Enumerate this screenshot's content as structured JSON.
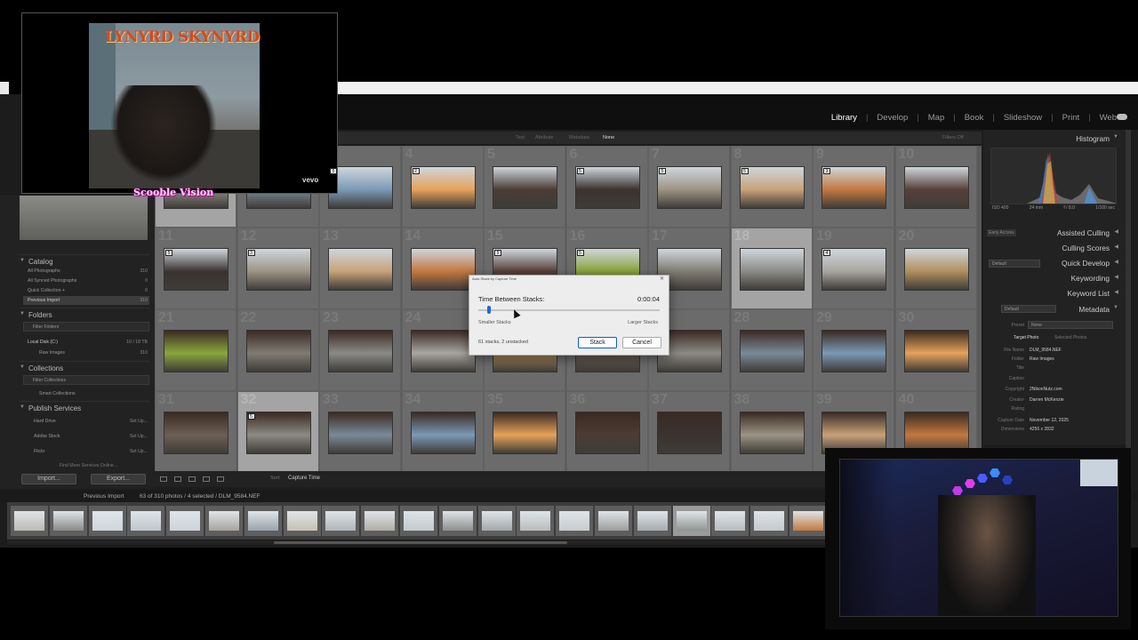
{
  "modules": [
    "Library",
    "Develop",
    "Map",
    "Book",
    "Slideshow",
    "Print",
    "Web"
  ],
  "active_module": "Library",
  "filter_bar": {
    "items": [
      "Text",
      "Attribute",
      "Metadata",
      "None"
    ],
    "right": "Filters Off"
  },
  "left_panel": {
    "catalog_title": "Catalog",
    "catalog_items": [
      {
        "label": "All Photographs",
        "count": "310"
      },
      {
        "label": "All Synced Photographs",
        "count": "0"
      },
      {
        "label": "Quick Collection +",
        "count": "0"
      },
      {
        "label": "Previous Import",
        "count": "310"
      }
    ],
    "folders_title": "Folders",
    "folders_filter": "Filter Folders",
    "disk_label": "Local Disk (C:)",
    "disk_info": "10 / 18 TB",
    "folder_item": {
      "label": "Raw Images",
      "count": "310"
    },
    "collections_title": "Collections",
    "collections_filter": "Filter Collections",
    "smart_collections": "Smart Collections",
    "publish_title": "Publish Services",
    "publish_items": [
      {
        "label": "Hard Drive",
        "action": "Set Up..."
      },
      {
        "label": "Adobe Stock",
        "action": "Set Up..."
      },
      {
        "label": "Flickr",
        "action": "Set Up..."
      }
    ],
    "find_more": "Find More Services Online...",
    "import_label": "Import...",
    "export_label": "Export..."
  },
  "grid": {
    "numbers": [
      "",
      "",
      "3",
      "4",
      "5",
      "6",
      "7",
      "8",
      "9",
      "10",
      "11",
      "12",
      "13",
      "14",
      "15",
      "16",
      "17",
      "18",
      "19",
      "20",
      "21",
      "22",
      "23",
      "24",
      "25",
      "26",
      "27",
      "28",
      "29",
      "30",
      "31",
      "32",
      "33",
      "34",
      "35",
      "36",
      "37",
      "38",
      "39",
      "40"
    ],
    "stack_badges": [
      "",
      "",
      "5",
      "2",
      "",
      "5",
      "5",
      "5",
      "3",
      "",
      "5",
      "3",
      "",
      "",
      "5",
      "5",
      "",
      "",
      "4",
      "",
      "",
      "",
      "",
      "",
      "",
      "",
      "",
      "",
      "",
      "",
      "",
      "5",
      "",
      "",
      "",
      "",
      "",
      "",
      "",
      ""
    ]
  },
  "toolbar": {
    "sort_label": "Sort:",
    "sort_value": "Capture Time"
  },
  "right_panel": {
    "histogram_title": "Histogram",
    "hist_info": [
      "ISO 400",
      "24 mm",
      "f / 8.0",
      "1/160 sec"
    ],
    "early_access": "Early Access",
    "sections": [
      "Assisted Culling",
      "Culling Scores",
      "Quick Develop",
      "Keywording",
      "Keyword List",
      "Metadata"
    ],
    "default_label": "Default",
    "preset_label": "Preset",
    "preset_value": "None",
    "target_photo": "Target Photo",
    "selected_photos": "Selected Photos",
    "metadata": [
      {
        "k": "File Name",
        "v": "DLM_9584.NEF"
      },
      {
        "k": "Folder",
        "v": "Raw Images"
      },
      {
        "k": "Title",
        "v": ""
      },
      {
        "k": "Caption",
        "v": ""
      },
      {
        "k": "Copyright",
        "v": "2NikonNutz.com"
      },
      {
        "k": "Creator",
        "v": "Darren McKenzie"
      },
      {
        "k": "Rating",
        "v": ""
      },
      {
        "k": "Capture Date",
        "v": "November 12, 2025"
      },
      {
        "k": "Dimensions",
        "v": "4256 x 2832"
      }
    ]
  },
  "filmstrip": {
    "source": "Previous Import",
    "info": "63 of 310 photos / 4 selected / DLM_9584.NEF"
  },
  "dialog": {
    "title": "Auto-Stack by Capture Time",
    "label": "Time Between Stacks:",
    "time": "0:00:04",
    "slider_fraction": 0.05,
    "min_label": "Smaller Stacks",
    "max_label": "Larger Stacks",
    "status": "61 stacks, 2 unstacked",
    "stack_button": "Stack",
    "cancel_button": "Cancel"
  },
  "overlay": {
    "album_band": "LYNYRD SKYNYRD",
    "vevo": "vevo",
    "caption": "Scooble Vision"
  },
  "colors": {
    "accent": "#1a6bd6",
    "panel": "#222222",
    "grid": "#5a5a5a"
  }
}
